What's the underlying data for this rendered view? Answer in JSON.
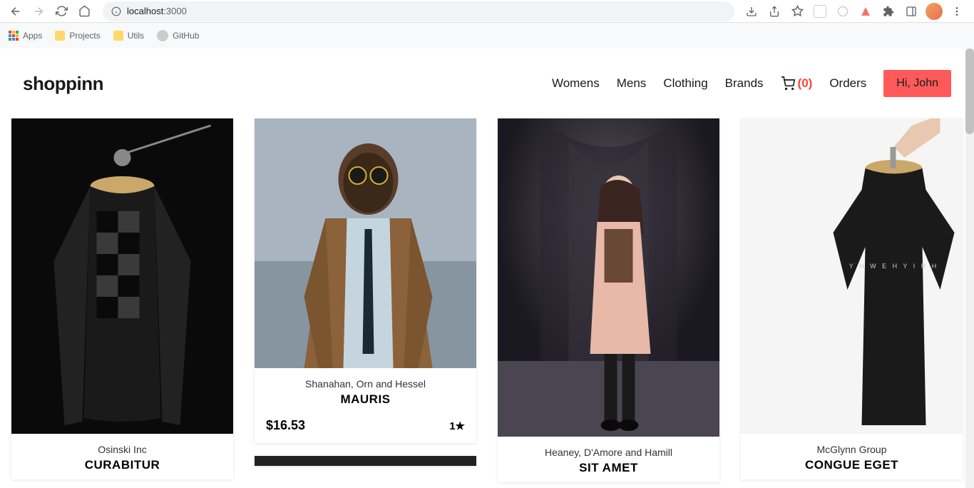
{
  "browser": {
    "url_prefix": "localhost",
    "url_port": ":3000",
    "bookmarks": [
      {
        "label": "Apps",
        "icon": "apps"
      },
      {
        "label": "Projects",
        "icon": "folder"
      },
      {
        "label": "Utils",
        "icon": "folder"
      },
      {
        "label": "GitHub",
        "icon": "github"
      }
    ]
  },
  "header": {
    "logo": "shoppinn",
    "nav": [
      "Womens",
      "Mens",
      "Clothing",
      "Brands"
    ],
    "cart_count": "(0)",
    "orders_label": "Orders",
    "user_greeting": "Hi, John"
  },
  "products": [
    {
      "brand": "Osinski Inc",
      "name": "CURABITUR",
      "price": "",
      "rating": "",
      "img": "shirt"
    },
    {
      "brand": "Shanahan, Orn and Hessel",
      "name": "MAURIS",
      "price": "$16.53",
      "rating": "1★",
      "img": "jacket"
    },
    {
      "brand": "Heaney, D'Amore and Hamill",
      "name": "SIT AMET",
      "price": "",
      "rating": "",
      "img": "coat"
    },
    {
      "brand": "McGlynn Group",
      "name": "CONGUE EGET",
      "price": "",
      "rating": "",
      "img": "tshirt"
    }
  ]
}
